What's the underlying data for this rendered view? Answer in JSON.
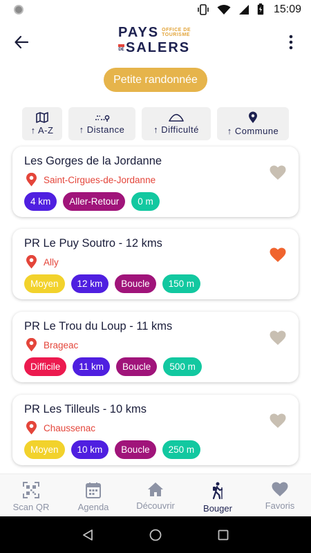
{
  "statusbar": {
    "time": "15:09"
  },
  "header": {
    "back_icon": "arrow-left-icon",
    "menu_icon": "more-vertical-icon",
    "logo": {
      "line1": "PAYS",
      "small1": "OFFICE DE",
      "small2": "TOURISME",
      "de": "DE",
      "line2": "SALERS"
    }
  },
  "filter": {
    "label": "Petite randonnée"
  },
  "sort": [
    {
      "label": "↑ A-Z",
      "icon": "map-icon"
    },
    {
      "label": "↑ Distance",
      "icon": "route-icon"
    },
    {
      "label": "↑ Difficulté",
      "icon": "hill-icon"
    },
    {
      "label": "↑ Commune",
      "icon": "pin-icon"
    }
  ],
  "colors": {
    "distance": "#4f1fe0",
    "type": "#a0147a",
    "elevation": "#12c8a0",
    "moyen": "#f2d22c",
    "difficile": "#ec1a4f",
    "heart_off": "#c8bfb2",
    "heart_on": "#f0642e",
    "accent": "#e6b44b"
  },
  "routes": [
    {
      "title": "Les Gorges de la Jordanne",
      "location": "Saint-Cirgues-de-Jordanne",
      "favorite": false,
      "tags": [
        {
          "text": "4 km",
          "kind": "distance"
        },
        {
          "text": "Aller-Retour",
          "kind": "type"
        },
        {
          "text": "0 m",
          "kind": "elevation"
        }
      ]
    },
    {
      "title": "PR Le Puy Soutro - 12 kms",
      "location": "Ally",
      "favorite": true,
      "tags": [
        {
          "text": "Moyen",
          "kind": "moyen"
        },
        {
          "text": "12 km",
          "kind": "distance"
        },
        {
          "text": "Boucle",
          "kind": "type"
        },
        {
          "text": "150 m",
          "kind": "elevation"
        }
      ]
    },
    {
      "title": "PR Le Trou du Loup - 11 kms",
      "location": "Brageac",
      "favorite": false,
      "tags": [
        {
          "text": "Difficile",
          "kind": "difficile"
        },
        {
          "text": "11 km",
          "kind": "distance"
        },
        {
          "text": "Boucle",
          "kind": "type"
        },
        {
          "text": "500 m",
          "kind": "elevation"
        }
      ]
    },
    {
      "title": "PR Les Tilleuls - 10 kms",
      "location": "Chaussenac",
      "favorite": false,
      "tags": [
        {
          "text": "Moyen",
          "kind": "moyen"
        },
        {
          "text": "10 km",
          "kind": "distance"
        },
        {
          "text": "Boucle",
          "kind": "type"
        },
        {
          "text": "250 m",
          "kind": "elevation"
        }
      ]
    }
  ],
  "bottomnav": [
    {
      "label": "Scan QR",
      "icon": "qr-code-icon",
      "active": false
    },
    {
      "label": "Agenda",
      "icon": "calendar-icon",
      "active": false
    },
    {
      "label": "Découvrir",
      "icon": "home-icon",
      "active": false
    },
    {
      "label": "Bouger",
      "icon": "hiker-icon",
      "active": true
    },
    {
      "label": "Favoris",
      "icon": "heart-icon",
      "active": false
    }
  ]
}
